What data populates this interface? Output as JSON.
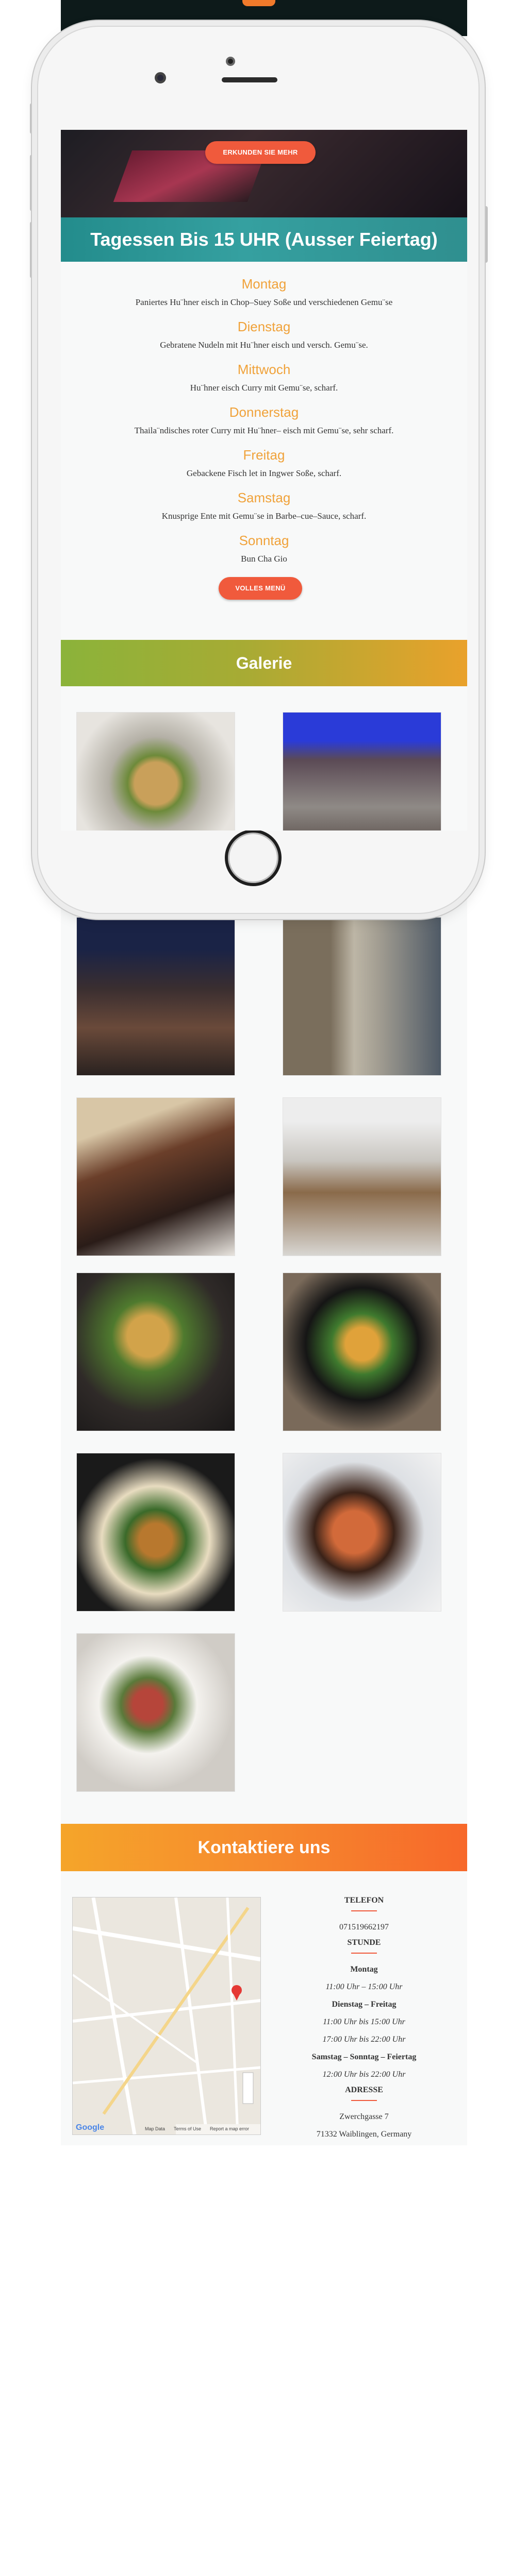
{
  "hero": {
    "button_label": "ERKUNDEN SIE MEHR"
  },
  "lunch": {
    "title": "Tagessen Bis 15 UHR (Ausser Feiertag)",
    "days": [
      {
        "day": "Montag",
        "dish": "Paniertes Hu¨hner eisch in Chop–Suey Soße und verschiedenen Gemu¨se"
      },
      {
        "day": "Dienstag",
        "dish": "Gebratene Nudeln mit Hu¨hner eisch und versch. Gemu¨se."
      },
      {
        "day": "Mittwoch",
        "dish": "Hu¨hner eisch Curry mit Gemu¨se, scharf."
      },
      {
        "day": "Donnerstag",
        "dish": "Thaila¨ndisches roter Curry mit Hu¨hner– eisch mit Gemu¨se, sehr scharf."
      },
      {
        "day": "Freitag",
        "dish": "Gebackene Fisch let in Ingwer Soße, scharf."
      },
      {
        "day": "Samstag",
        "dish": "Knusprige Ente mit Gemu¨se in Barbe–cue–Sauce, scharf."
      },
      {
        "day": "Sonntag",
        "dish": "Bun Cha Gio"
      }
    ],
    "full_menu_label": "VOLLES MENÜ"
  },
  "gallery": {
    "title": "Galerie",
    "images": [
      {
        "name": "gallery-image-salad-dish"
      },
      {
        "name": "gallery-image-restaurant-exterior-blue-light"
      },
      {
        "name": "gallery-image-bar-interior"
      },
      {
        "name": "gallery-image-alley-street"
      },
      {
        "name": "gallery-image-dining-room"
      },
      {
        "name": "gallery-image-building-entrance"
      },
      {
        "name": "gallery-image-crepe-platter"
      },
      {
        "name": "gallery-image-vegetable-bowl"
      },
      {
        "name": "gallery-image-fried-dish-plate"
      },
      {
        "name": "gallery-image-shrimp-claypot"
      },
      {
        "name": "gallery-image-pho-bowl"
      }
    ]
  },
  "contact": {
    "title": "Kontaktiere uns",
    "phone_heading": "TELEFON",
    "phone": "071519662197",
    "hours_heading": "STUNDE",
    "hours": [
      {
        "label": "Montag",
        "time": "11:00 Uhr – 15:00 Uhr"
      },
      {
        "label": "Dienstag – Freitag",
        "time": "11:00 Uhr bis 15:00 Uhr"
      },
      {
        "label": "",
        "time": "17:00 Uhr bis 22:00 Uhr"
      },
      {
        "label": "Samstag – Sonntag – Feiertag",
        "time": "12:00 Uhr bis 22:00 Uhr"
      }
    ],
    "address_heading": "ADRESSE",
    "street": "Zwerchgasse 7",
    "city": "71332 Waiblingen, Germany"
  },
  "map": {
    "footer": [
      "Map Data",
      "Terms of Use",
      "Report a map error"
    ],
    "google": "Google"
  },
  "colors": {
    "accent": "#f05a3c",
    "day_text": "#f0a23a",
    "teal": "#2f9696"
  }
}
